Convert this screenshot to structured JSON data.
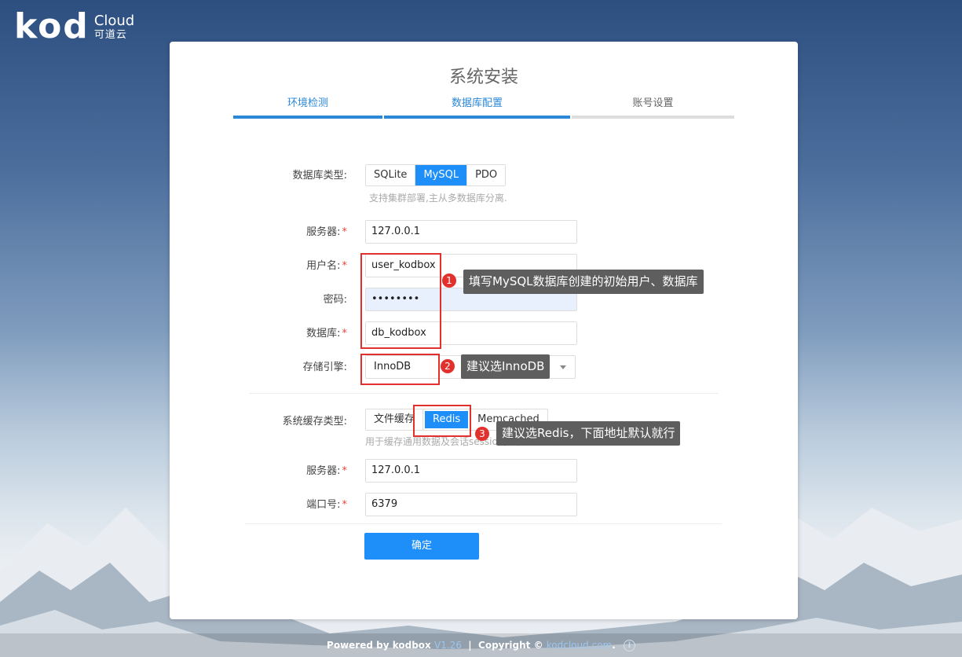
{
  "logo": {
    "brand": "kod",
    "cloud": "Cloud",
    "cn": "可道云"
  },
  "panel": {
    "title": "系统安装"
  },
  "steps": [
    {
      "label": "环境检测",
      "state": "done"
    },
    {
      "label": "数据库配置",
      "state": "done"
    },
    {
      "label": "账号设置",
      "state": "todo"
    }
  ],
  "db": {
    "type_label": "数据库类型:",
    "types": [
      "SQLite",
      "MySQL",
      "PDO"
    ],
    "selected_type": "MySQL",
    "type_hint": "支持集群部署,主从多数据库分离.",
    "server_label": "服务器:",
    "server_value": "127.0.0.1",
    "user_label": "用户名:",
    "user_value": "user_kodbox",
    "password_label": "密码:",
    "password_value": "••••••••",
    "dbname_label": "数据库:",
    "dbname_value": "db_kodbox",
    "engine_label": "存储引擎:",
    "engine_value": "InnoDB"
  },
  "cache": {
    "type_label": "系统缓存类型:",
    "types": [
      "文件缓存",
      "Redis",
      "Memcached"
    ],
    "selected_type": "Redis",
    "type_hint": "用于缓存通用数据及会话session,加快系统访问",
    "server_label": "服务器:",
    "server_value": "127.0.0.1",
    "port_label": "端口号:",
    "port_value": "6379"
  },
  "confirm_label": "确定",
  "annotations": [
    {
      "num": "1",
      "text": "填写MySQL数据库创建的初始用户、数据库"
    },
    {
      "num": "2",
      "text": "建议选InnoDB"
    },
    {
      "num": "3",
      "text": "建议选Redis，下面地址默认就行"
    }
  ],
  "footer": {
    "powered": "Powered by kodbox",
    "version": "V1.26",
    "sep": "|",
    "copyright": "Copyright ©",
    "link": "kodcloud.com",
    "dot": "."
  },
  "colors": {
    "accent": "#1e8ff8",
    "step_active": "#2b88d8",
    "annotation_red": "#e2312d",
    "tip_bg": "#5e5e5e"
  }
}
